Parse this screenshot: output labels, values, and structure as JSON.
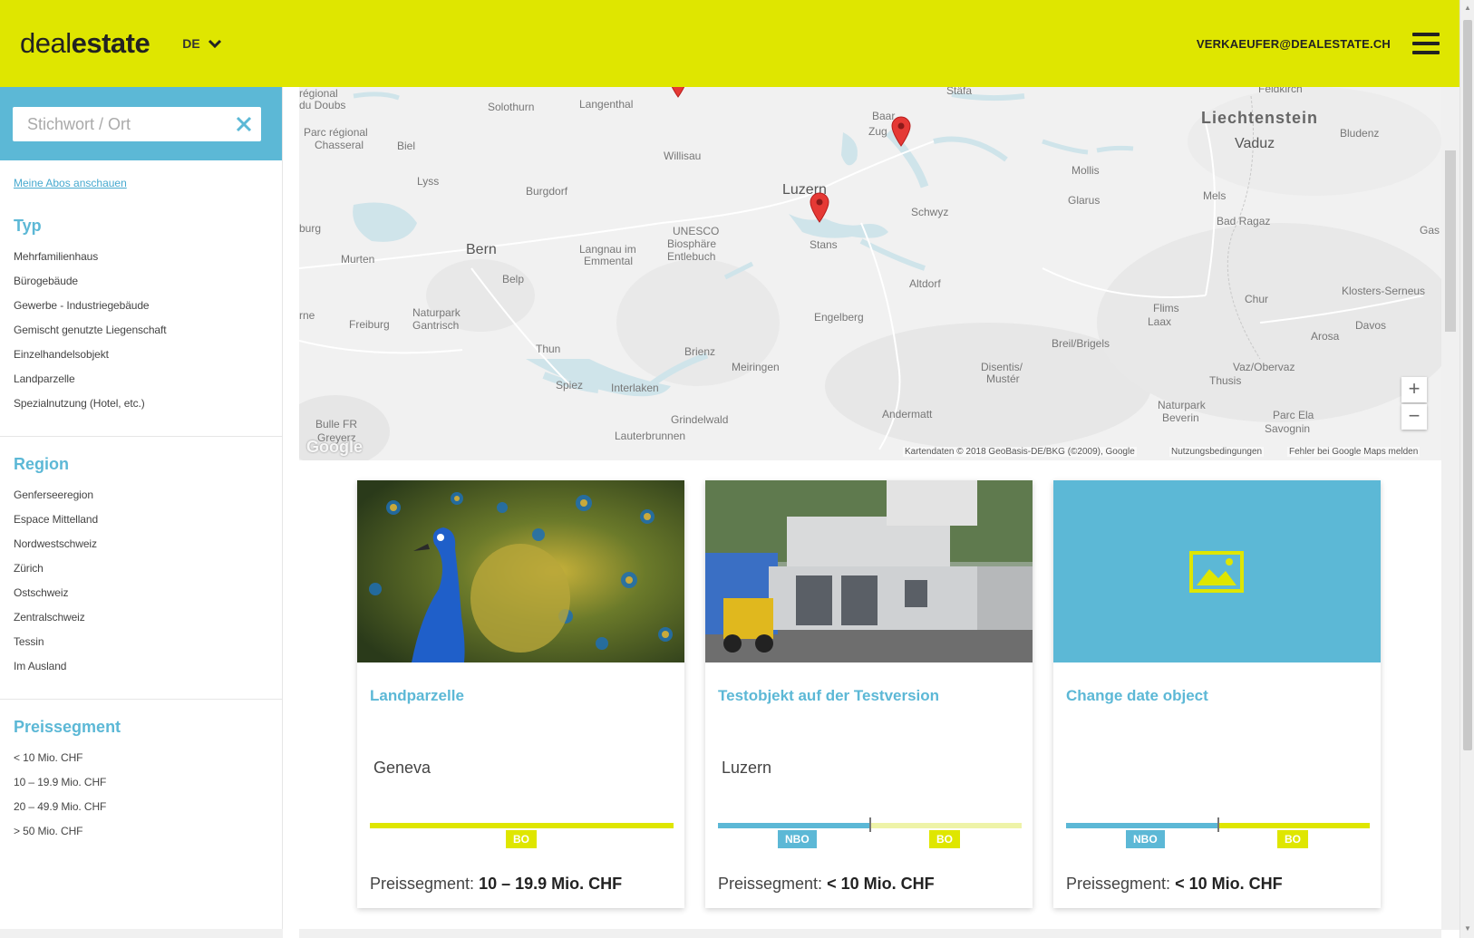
{
  "header": {
    "logo_part1": "deal",
    "logo_part2": "estate",
    "language": "DE",
    "user_email": "VERKAEUFER@DEALESTATE.CH"
  },
  "search": {
    "placeholder": "Stichwort / Ort",
    "value": ""
  },
  "sidebar": {
    "abos_link": "Meine Abos anschauen",
    "typ": {
      "title": "Typ",
      "items": [
        "Mehrfamilienhaus",
        "Bürogebäude",
        "Gewerbe - Industriegebäude",
        "Gemischt genutzte Liegenschaft",
        "Einzelhandelsobjekt",
        "Landparzelle",
        "Spezialnutzung (Hotel, etc.)"
      ]
    },
    "region": {
      "title": "Region",
      "items": [
        "Genferseeregion",
        "Espace Mittelland",
        "Nordwestschweiz",
        "Zürich",
        "Ostschweiz",
        "Zentralschweiz",
        "Tessin",
        "Im Ausland"
      ]
    },
    "preissegment": {
      "title": "Preissegment",
      "items": [
        "< 10 Mio. CHF",
        "10 – 19.9 Mio. CHF",
        "20 – 49.9 Mio. CHF",
        "> 50 Mio. CHF"
      ]
    }
  },
  "map": {
    "labels": {
      "liechtenstein": "Liechtenstein",
      "bern": "Bern",
      "luzern": "Luzern",
      "vaduz": "Vaduz",
      "regional": "régional",
      "du_doubs": "du Doubs",
      "solothurn": "Solothurn",
      "langenthal": "Langenthal",
      "stafa": "Stäfa",
      "feldkirch": "Feldkirch",
      "baar": "Baar",
      "zug": "Zug",
      "bludenz": "Bludenz",
      "parc_regional": "Parc régional",
      "chasseral": "Chasseral",
      "biel": "Biel",
      "willisau": "Willisau",
      "mollis": "Mollis",
      "lyss": "Lyss",
      "burgdorf": "Burgdorf",
      "glarus": "Glarus",
      "mels": "Mels",
      "schwyz": "Schwyz",
      "bad_ragaz": "Bad Ragaz",
      "gas": "Gas",
      "burg": "burg",
      "unesco1": "UNESCO",
      "unesco2": "Biosphäre",
      "unesco3": "Entlebuch",
      "langnau1": "Langnau im",
      "langnau2": "Emmental",
      "stans": "Stans",
      "murten": "Murten",
      "belp": "Belp",
      "altdorf": "Altdorf",
      "klosters": "Klosters-Serneus",
      "rne": "rne",
      "fribourg": "Freiburg",
      "naturpark1": "Naturpark",
      "naturpark2": "Gantrisch",
      "engelberg": "Engelberg",
      "flims": "Flims",
      "laax": "Laax",
      "chur": "Chur",
      "davos": "Davos",
      "arosa": "Arosa",
      "breil": "Breil/Brigels",
      "thun": "Thun",
      "brienz": "Brienz",
      "meiringen": "Meiringen",
      "disentis1": "Disentis/",
      "disentis2": "Mustér",
      "vaz": "Vaz/Obervaz",
      "thusis": "Thusis",
      "spiez": "Spiez",
      "interlaken": "Interlaken",
      "grindelwald": "Grindelwald",
      "andermatt": "Andermatt",
      "beverin1": "Naturpark",
      "beverin2": "Beverin",
      "parc_ela": "Parc Ela",
      "savognin": "Savognin",
      "bulle": "Bulle FR",
      "gruyere": "Greyerz",
      "lauterbrunnen": "Lauterbrunnen"
    },
    "zoom_in": "+",
    "zoom_out": "−",
    "google": "Google",
    "attribution": "Kartendaten © 2018 GeoBasis-DE/BKG (©2009), Google",
    "terms": "Nutzungsbedingungen",
    "report": "Fehler bei Google Maps melden"
  },
  "cards": [
    {
      "title": "Landparzelle",
      "location": "Geneva",
      "price_label": "Preissegment:",
      "price_value": "10 – 19.9 Mio. CHF",
      "badges": [
        "BO"
      ]
    },
    {
      "title": "Testobjekt auf der Testversion",
      "location": "Luzern",
      "price_label": "Preissegment:",
      "price_value": "< 10 Mio. CHF",
      "badges": [
        "NBO",
        "BO"
      ]
    },
    {
      "title": "Change date object",
      "location": "",
      "price_label": "Preissegment:",
      "price_value": "< 10 Mio. CHF",
      "badges": [
        "NBO",
        "BO"
      ]
    }
  ],
  "colors": {
    "accent_yellow": "#dfe600",
    "accent_blue": "#5cb8d6",
    "pin_red": "#e53935"
  }
}
